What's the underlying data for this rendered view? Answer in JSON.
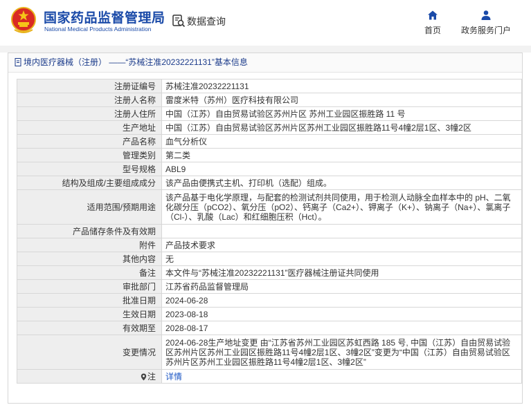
{
  "header": {
    "org_name_cn": "国家药品监督管理局",
    "org_name_en": "National Medical Products Administration",
    "query_label": "数据查询",
    "nav": [
      {
        "label": "首页",
        "icon": "home-icon"
      },
      {
        "label": "政务服务门户",
        "icon": "user-icon"
      }
    ]
  },
  "breadcrumb": "境内医疗器械（注册） ——“苏械注准20232221131”基本信息",
  "rows": [
    {
      "key": "注册证编号",
      "value": "苏械注准20232221131"
    },
    {
      "key": "注册人名称",
      "value": "雷度米特（苏州）医疗科技有限公司"
    },
    {
      "key": "注册人住所",
      "value": "中国（江苏）自由贸易试验区苏州片区 苏州工业园区振胜路 11 号"
    },
    {
      "key": "生产地址",
      "value": "中国（江苏）自由贸易试验区苏州片区苏州工业园区振胜路11号4幢2层1区、3幢2区"
    },
    {
      "key": "产品名称",
      "value": "血气分析仪"
    },
    {
      "key": "管理类别",
      "value": "第二类"
    },
    {
      "key": "型号规格",
      "value": "ABL9"
    },
    {
      "key": "结构及组成/主要组成成分",
      "value": "该产品由便携式主机、打印机（选配）组成。"
    },
    {
      "key": "适用范围/预期用途",
      "value": "该产品基于电化学原理，与配套的检测试剂共同使用，用于检测人动脉全血样本中的 pH、二氧化碳分压（pCO2）、氧分压（pO2）、钙离子（Ca2+）、钾离子（K+）、钠离子（Na+）、氯离子（Cl-）、乳酸（Lac）和红细胞压积（Hct）。"
    },
    {
      "key": "产品储存条件及有效期",
      "value": ""
    },
    {
      "key": "附件",
      "value": "产品技术要求"
    },
    {
      "key": "其他内容",
      "value": "无"
    },
    {
      "key": "备注",
      "value": "本文件与“苏械注准20232221131”医疗器械注册证共同使用"
    },
    {
      "key": "审批部门",
      "value": "江苏省药品监督管理局"
    },
    {
      "key": "批准日期",
      "value": "2024-06-28"
    },
    {
      "key": "生效日期",
      "value": "2023-08-18"
    },
    {
      "key": "有效期至",
      "value": "2028-08-17"
    },
    {
      "key": "变更情况",
      "value": "2024-06-28生产地址变更 由“江苏省苏州工业园区苏虹西路 185 号, 中国（江苏）自由贸易试验区苏州片区苏州工业园区振胜路11号4幢2层1区、3幢2区”变更为“中国（江苏）自由贸易试验区苏州片区苏州工业园区振胜路11号4幢2层1区、3幢2区”"
    },
    {
      "key": "注",
      "value": "详情"
    }
  ],
  "colors": {
    "brand": "#1a4aa8",
    "link": "#1a55c4",
    "key_bg": "#eeeeee"
  }
}
